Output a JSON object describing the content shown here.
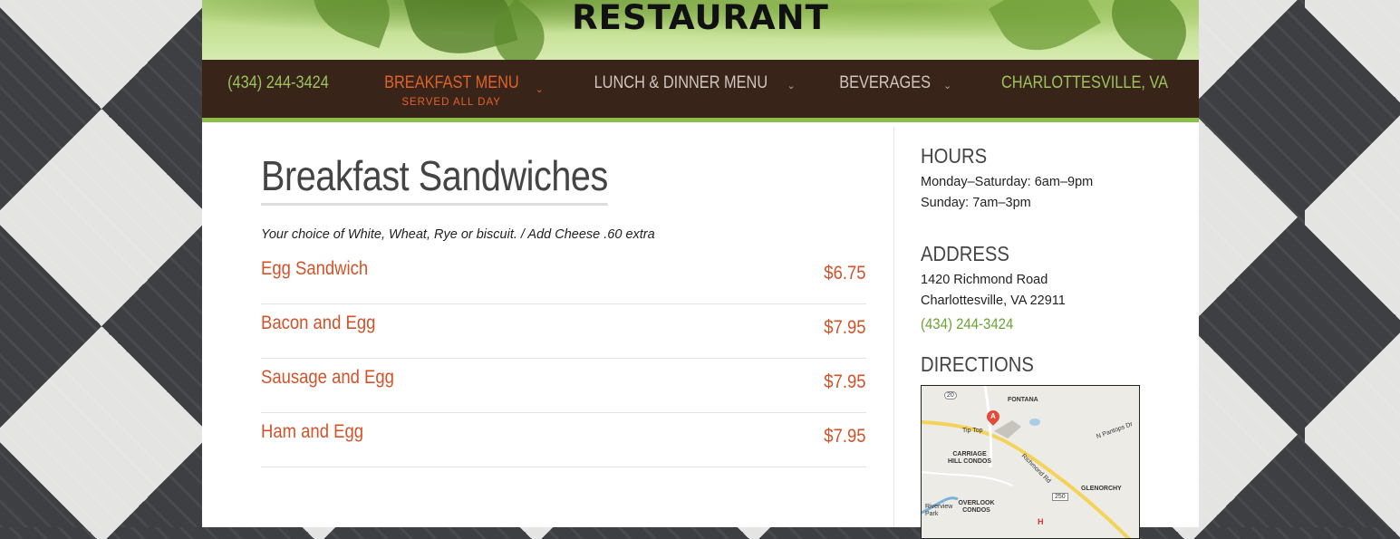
{
  "header": {
    "title": "RESTAURANT"
  },
  "nav": {
    "items": [
      {
        "label": "(434) 244-3424",
        "color": "#9bc45e"
      },
      {
        "label": "BREAKFAST MENU",
        "sub": "SERVED ALL DAY",
        "color": "#e0622b",
        "has_dropdown": true,
        "active": true
      },
      {
        "label": "LUNCH & DINNER MENU",
        "color": "#cfc6bf",
        "has_dropdown": true
      },
      {
        "label": "BEVERAGES",
        "color": "#cfc6bf",
        "has_dropdown": true
      },
      {
        "label": "CHARLOTTESVILLE, VA",
        "color": "#9bc45e"
      }
    ],
    "chevron_icon": "chevron-down-icon"
  },
  "main": {
    "title": "Breakfast Sandwiches",
    "description": "Your choice of White, Wheat, Rye or biscuit. / Add Cheese .60 extra",
    "items": [
      {
        "name": "Egg Sandwich",
        "price": "$6.75"
      },
      {
        "name": "Bacon and Egg",
        "price": "$7.95"
      },
      {
        "name": "Sausage and Egg",
        "price": "$7.95"
      },
      {
        "name": "Ham and Egg",
        "price": "$7.95"
      }
    ]
  },
  "sidebar": {
    "hours": {
      "heading": "HOURS",
      "lines": [
        "Monday–Saturday: 6am–9pm",
        "Sunday: 7am–3pm"
      ]
    },
    "address": {
      "heading": "ADDRESS",
      "lines": [
        "1420 Richmond Road",
        "Charlottesville, VA 22911"
      ],
      "phone": "(434) 244-3424"
    },
    "directions": {
      "heading": "DIRECTIONS",
      "map_labels": {
        "fontana": "FONTANA",
        "tiptop": "Tip Top",
        "pantops": "N Pantops Dr",
        "carriage": "CARRIAGE HILL CONDOS",
        "richmond": "Richmond Rd",
        "glenorchy": "GLENORCHY",
        "overlook": "OVERLOOK CONDOS",
        "riverview": "Riverview Park",
        "route20": "20",
        "route250": "250",
        "pin": "A",
        "hospital": "H"
      }
    }
  },
  "colors": {
    "accent_orange": "#d2532a",
    "accent_green": "#6aa334",
    "nav_bg": "#392419"
  }
}
